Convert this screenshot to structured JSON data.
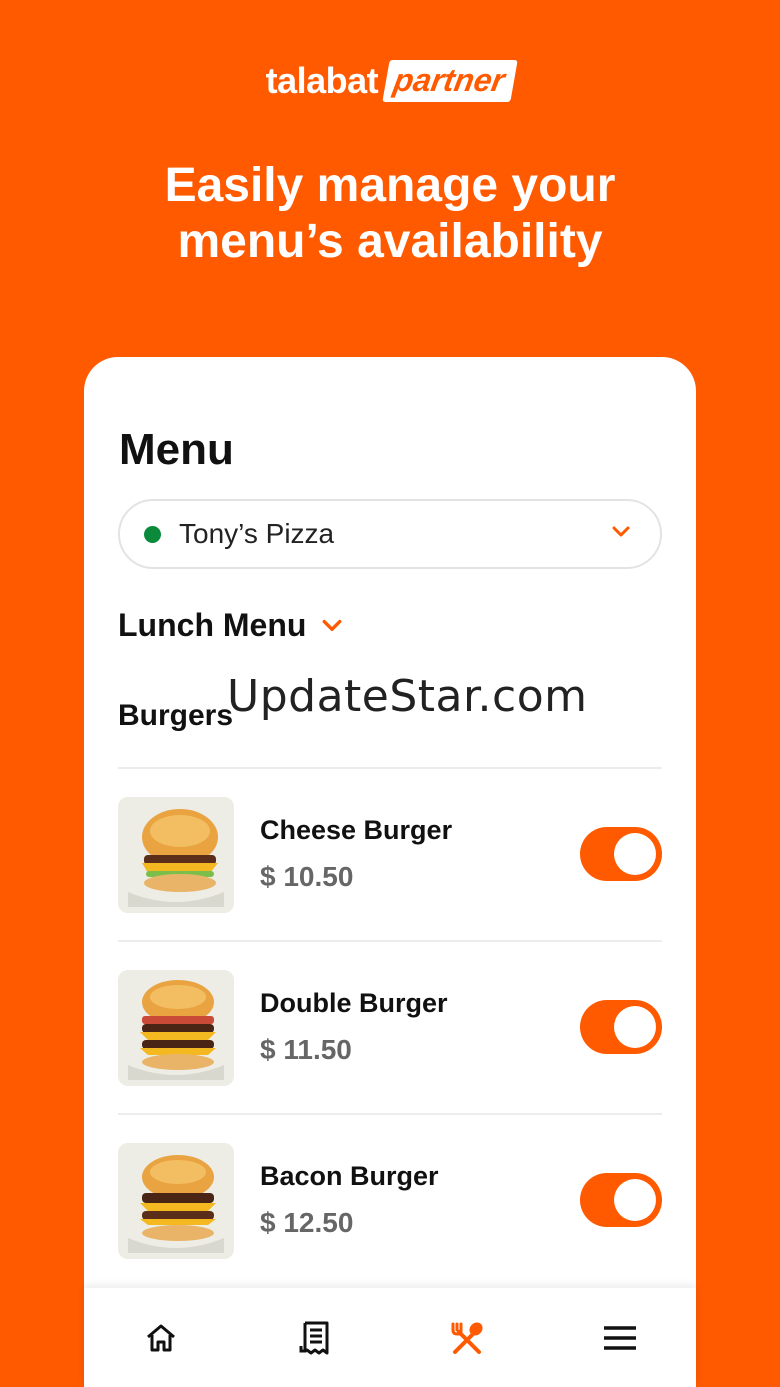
{
  "brand": {
    "name": "talabat",
    "tag": "partner"
  },
  "headline": {
    "line1": "Easily manage your",
    "line2": "menu’s availability"
  },
  "card": {
    "title": "Menu",
    "store": {
      "name": "Tony’s Pizza",
      "status_color": "#0A8A3A"
    },
    "menu_selector": "Lunch Menu",
    "section": "Burgers",
    "watermark": "UpdateStar.com",
    "items": [
      {
        "name": "Cheese Burger",
        "price": "$ 10.50",
        "available": true
      },
      {
        "name": "Double Burger",
        "price": "$ 11.50",
        "available": true
      },
      {
        "name": "Bacon Burger",
        "price": "$ 12.50",
        "available": true
      }
    ]
  },
  "bottom_nav": [
    {
      "icon": "home-icon",
      "active": false
    },
    {
      "icon": "receipt-icon",
      "active": false
    },
    {
      "icon": "menu-utensils-icon",
      "active": true
    },
    {
      "icon": "hamburger-menu-icon",
      "active": false
    }
  ],
  "colors": {
    "accent": "#FF5A00",
    "online": "#0A8A3A"
  }
}
